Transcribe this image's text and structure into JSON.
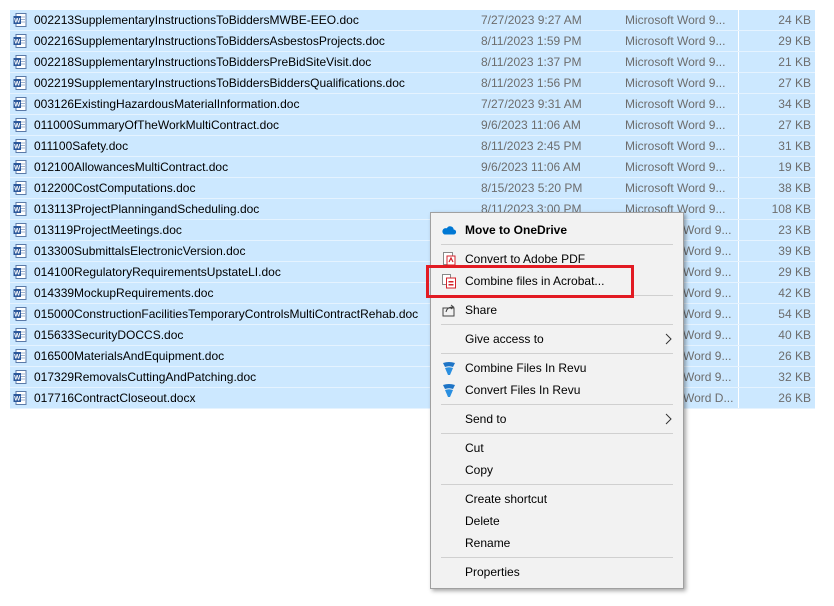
{
  "files": [
    {
      "name": "002213SupplementaryInstructionsToBiddersMWBE-EEO.doc",
      "date": "7/27/2023 9:27 AM",
      "type": "Microsoft Word 9...",
      "size": "24 KB",
      "icon": "word-doc-icon"
    },
    {
      "name": "002216SupplementaryInstructionsToBiddersAsbestosProjects.doc",
      "date": "8/11/2023 1:59 PM",
      "type": "Microsoft Word 9...",
      "size": "29 KB",
      "icon": "word-doc-icon"
    },
    {
      "name": "002218SupplementaryInstructionsToBiddersPreBidSiteVisit.doc",
      "date": "8/11/2023 1:37 PM",
      "type": "Microsoft Word 9...",
      "size": "21 KB",
      "icon": "word-doc-icon"
    },
    {
      "name": "002219SupplementaryInstructionsToBiddersBiddersQualifications.doc",
      "date": "8/11/2023 1:56 PM",
      "type": "Microsoft Word 9...",
      "size": "27 KB",
      "icon": "word-doc-icon"
    },
    {
      "name": "003126ExistingHazardousMaterialInformation.doc",
      "date": "7/27/2023 9:31 AM",
      "type": "Microsoft Word 9...",
      "size": "34 KB",
      "icon": "word-doc-icon"
    },
    {
      "name": "011000SummaryOfTheWorkMultiContract.doc",
      "date": "9/6/2023 11:06 AM",
      "type": "Microsoft Word 9...",
      "size": "27 KB",
      "icon": "word-doc-icon"
    },
    {
      "name": "011100Safety.doc",
      "date": "8/11/2023 2:45 PM",
      "type": "Microsoft Word 9...",
      "size": "31 KB",
      "icon": "word-doc-icon"
    },
    {
      "name": "012100AllowancesMultiContract.doc",
      "date": "9/6/2023 11:06 AM",
      "type": "Microsoft Word 9...",
      "size": "19 KB",
      "icon": "word-doc-icon"
    },
    {
      "name": "012200CostComputations.doc",
      "date": "8/15/2023 5:20 PM",
      "type": "Microsoft Word 9...",
      "size": "38 KB",
      "icon": "word-doc-icon"
    },
    {
      "name": "013113ProjectPlanningandScheduling.doc",
      "date": "8/11/2023 3:00 PM",
      "type": "Microsoft Word 9...",
      "size": "108 KB",
      "icon": "word-doc-icon"
    },
    {
      "name": "013119ProjectMeetings.doc",
      "date": "",
      "type": "Word 9...",
      "size": "23 KB",
      "icon": "word-doc-icon"
    },
    {
      "name": "013300SubmittalsElectronicVersion.doc",
      "date": "",
      "type": "Word 9...",
      "size": "39 KB",
      "icon": "word-doc-icon"
    },
    {
      "name": "014100RegulatoryRequirementsUpstateLI.doc",
      "date": "",
      "type": "Word 9...",
      "size": "29 KB",
      "icon": "word-doc-icon"
    },
    {
      "name": "014339MockupRequirements.doc",
      "date": "",
      "type": "Word 9...",
      "size": "42 KB",
      "icon": "word-doc-icon"
    },
    {
      "name": "015000ConstructionFacilitiesTemporaryControlsMultiContractRehab.doc",
      "date": "",
      "type": "Word 9...",
      "size": "54 KB",
      "icon": "word-doc-icon"
    },
    {
      "name": "015633SecurityDOCCS.doc",
      "date": "",
      "type": "Word 9...",
      "size": "40 KB",
      "icon": "word-doc-icon"
    },
    {
      "name": "016500MaterialsAndEquipment.doc",
      "date": "",
      "type": "Word 9...",
      "size": "26 KB",
      "icon": "word-doc-icon"
    },
    {
      "name": "017329RemovalsCuttingAndPatching.doc",
      "date": "",
      "type": "Word 9...",
      "size": "32 KB",
      "icon": "word-doc-icon"
    },
    {
      "name": "017716ContractCloseout.docx",
      "date": "",
      "type": "Word D...",
      "size": "26 KB",
      "icon": "word-docx-icon"
    }
  ],
  "context_menu": {
    "items": [
      {
        "id": "move-to-onedrive",
        "label": "Move to OneDrive",
        "bold": true,
        "icon": "onedrive-icon",
        "submenu": false
      },
      {
        "id": "convert-to-adobe-pdf",
        "label": "Convert to Adobe PDF",
        "bold": false,
        "icon": "adobe-pdf-icon",
        "submenu": false
      },
      {
        "id": "combine-files-in-acrobat",
        "label": "Combine files in Acrobat...",
        "bold": false,
        "icon": "acrobat-combine-icon",
        "submenu": false
      },
      {
        "id": "share",
        "label": "Share",
        "bold": false,
        "icon": "share-icon",
        "submenu": false
      },
      {
        "id": "give-access-to",
        "label": "Give access to",
        "bold": false,
        "icon": "",
        "submenu": true
      },
      {
        "id": "combine-files-in-revu",
        "label": "Combine Files In Revu",
        "bold": false,
        "icon": "bluebeam-revu-icon",
        "submenu": false
      },
      {
        "id": "convert-files-in-revu",
        "label": "Convert Files In Revu",
        "bold": false,
        "icon": "bluebeam-revu-icon",
        "submenu": false
      },
      {
        "id": "send-to",
        "label": "Send to",
        "bold": false,
        "icon": "",
        "submenu": true
      },
      {
        "id": "cut",
        "label": "Cut",
        "bold": false,
        "icon": "",
        "submenu": false
      },
      {
        "id": "copy",
        "label": "Copy",
        "bold": false,
        "icon": "",
        "submenu": false
      },
      {
        "id": "create-shortcut",
        "label": "Create shortcut",
        "bold": false,
        "icon": "",
        "submenu": false
      },
      {
        "id": "delete",
        "label": "Delete",
        "bold": false,
        "icon": "",
        "submenu": false
      },
      {
        "id": "rename",
        "label": "Rename",
        "bold": false,
        "icon": "",
        "submenu": false
      },
      {
        "id": "properties",
        "label": "Properties",
        "bold": false,
        "icon": "",
        "submenu": false
      }
    ]
  },
  "colors": {
    "selection": "#cce8ff",
    "menu_bg": "#f2f2f2",
    "highlight_border": "#e21b23",
    "word_blue": "#2b579a",
    "onedrive_blue": "#0078d4",
    "acrobat_red": "#d4212a",
    "revu_blue": "#1e74c6"
  }
}
